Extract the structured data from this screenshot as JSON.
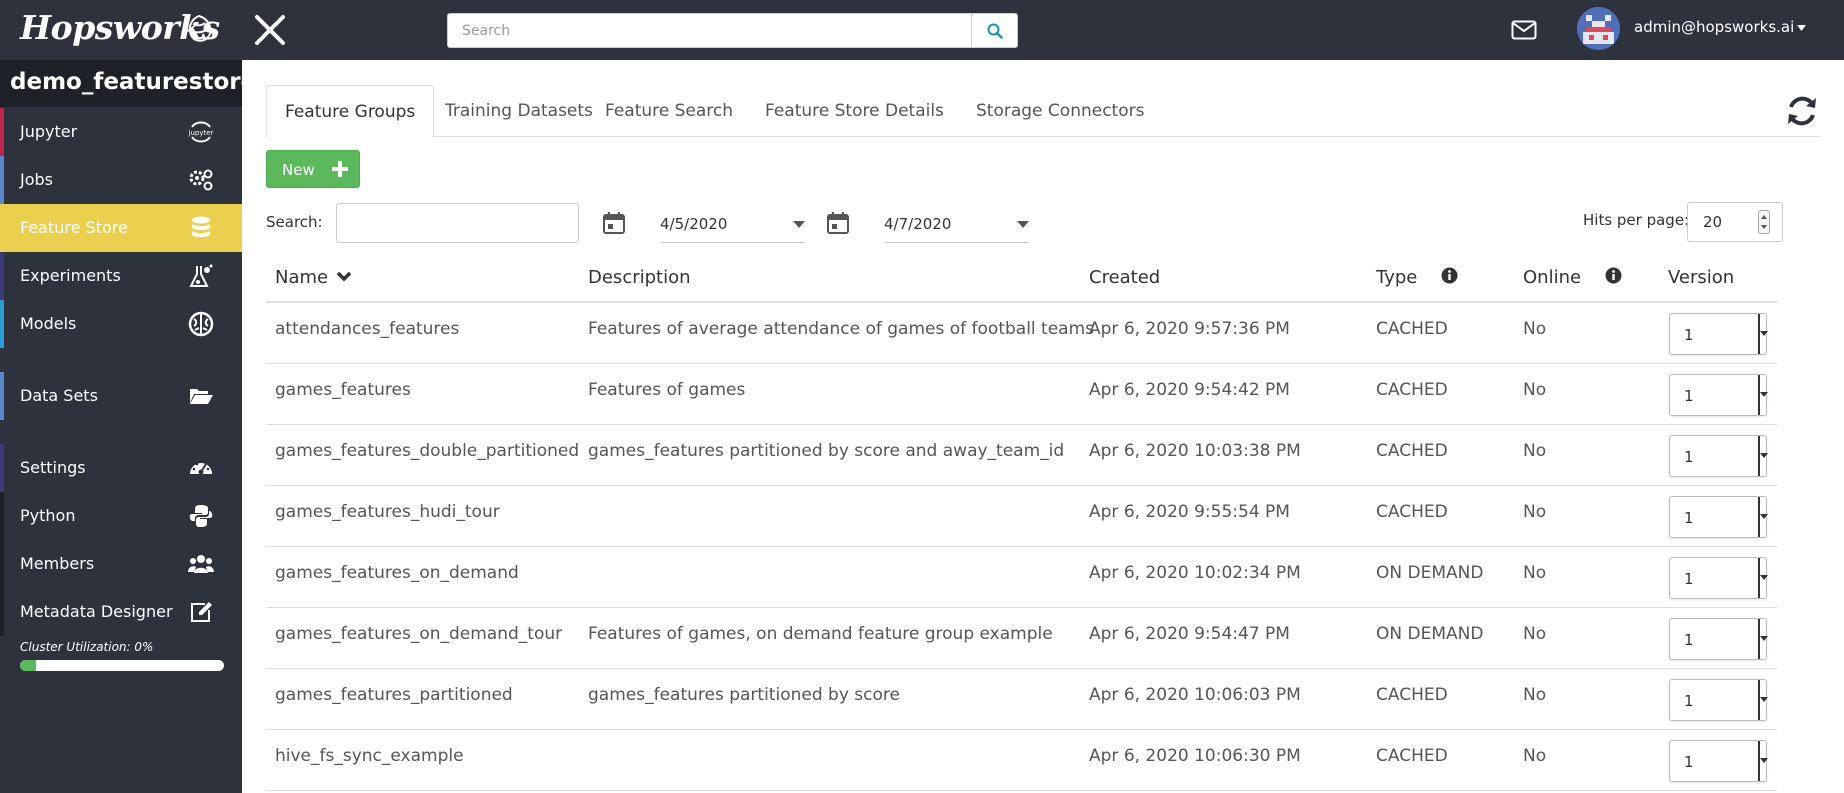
{
  "brand": {
    "name": "Hopsworks"
  },
  "search": {
    "placeholder": "Search"
  },
  "user": {
    "email": "admin@hopsworks.ai"
  },
  "project": {
    "name": "demo_featurestore..."
  },
  "sidebar": {
    "items": [
      {
        "label": "Jupyter",
        "icon": "jupyter-icon",
        "accent": "#c0234d"
      },
      {
        "label": "Jobs",
        "icon": "gears-icon",
        "accent": "#5b86c9"
      },
      {
        "label": "Feature Store",
        "icon": "database-icon",
        "accent": "#ebd04f"
      },
      {
        "label": "Experiments",
        "icon": "experiment-icon",
        "accent": "#3d3a77"
      },
      {
        "label": "Models",
        "icon": "brain-icon",
        "accent": "#2a9fd6"
      },
      {
        "label": "Data Sets",
        "icon": "folder-open-icon",
        "accent": "#5b86c9"
      },
      {
        "label": "Settings",
        "icon": "dashboard-icon",
        "accent": "#3d3a77"
      },
      {
        "label": "Python",
        "icon": "python-icon",
        "accent": "#1e2127"
      },
      {
        "label": "Members",
        "icon": "users-icon",
        "accent": "#1e2127"
      },
      {
        "label": "Metadata Designer",
        "icon": "edit-icon",
        "accent": "#1e2127"
      }
    ],
    "cluster_utilization_label": "Cluster Utilization: 0%",
    "cluster_utilization": 0
  },
  "tabs": [
    "Feature Groups",
    "Training Datasets",
    "Feature Search",
    "Feature Store Details",
    "Storage Connectors"
  ],
  "toolbar": {
    "new_label": "New",
    "search_label": "Search:",
    "search_value": "",
    "date_from": "4/5/2020",
    "date_to": "4/7/2020",
    "hits_label": "Hits per page:",
    "hits_value": "20"
  },
  "table": {
    "columns": [
      "Name",
      "Description",
      "Created",
      "Type",
      "Online",
      "Version"
    ],
    "rows": [
      {
        "name": "attendances_features",
        "description": "Features of average attendance of games of football teams",
        "created": "Apr 6, 2020 9:57:36 PM",
        "type": "CACHED",
        "online": "No",
        "version": "1"
      },
      {
        "name": "games_features",
        "description": "Features of games",
        "created": "Apr 6, 2020 9:54:42 PM",
        "type": "CACHED",
        "online": "No",
        "version": "1"
      },
      {
        "name": "games_features_double_partitioned",
        "description": "games_features partitioned by score and away_team_id",
        "created": "Apr 6, 2020 10:03:38 PM",
        "type": "CACHED",
        "online": "No",
        "version": "1"
      },
      {
        "name": "games_features_hudi_tour",
        "description": "",
        "created": "Apr 6, 2020 9:55:54 PM",
        "type": "CACHED",
        "online": "No",
        "version": "1"
      },
      {
        "name": "games_features_on_demand",
        "description": "",
        "created": "Apr 6, 2020 10:02:34 PM",
        "type": "ON DEMAND",
        "online": "No",
        "version": "1"
      },
      {
        "name": "games_features_on_demand_tour",
        "description": "Features of games, on demand feature group example",
        "created": "Apr 6, 2020 9:54:47 PM",
        "type": "ON DEMAND",
        "online": "No",
        "version": "1"
      },
      {
        "name": "games_features_partitioned",
        "description": "games_features partitioned by score",
        "created": "Apr 6, 2020 10:06:03 PM",
        "type": "CACHED",
        "online": "No",
        "version": "1"
      },
      {
        "name": "hive_fs_sync_example",
        "description": "",
        "created": "Apr 6, 2020 10:06:30 PM",
        "type": "CACHED",
        "online": "No",
        "version": "1"
      }
    ]
  }
}
